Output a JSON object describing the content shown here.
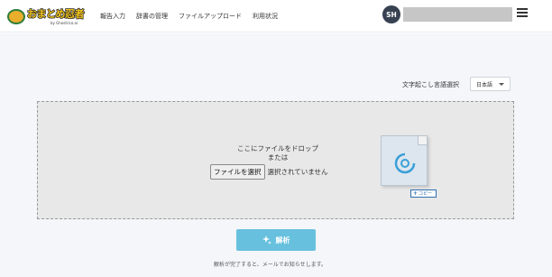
{
  "header": {
    "logo": {
      "brand": "おまとめ忍者",
      "sub": "by Ghostrico.ai"
    },
    "nav": [
      "報告入力",
      "辞書の管理",
      "ファイルアップロード",
      "利用状況"
    ],
    "avatar_initials": "SH",
    "menu_icon": "hamburger-icon"
  },
  "language": {
    "label": "文字起こし言語選択",
    "selected": "日本語"
  },
  "dropzone": {
    "line1": "ここにファイルをドロップ",
    "line2": "または",
    "choose_button": "ファイルを選択",
    "no_file_text": "選択されていません",
    "copy_badge": "コピー"
  },
  "analyze_button": {
    "label": "解析",
    "icon": "sparkle-icon"
  },
  "note": "解析が完了すると、メールでお知らせします。",
  "colors": {
    "accent": "#67c1de",
    "avatar_bg": "#374151",
    "logo_yellow": "#f2c31b",
    "logo_green": "#2f7d3a"
  }
}
